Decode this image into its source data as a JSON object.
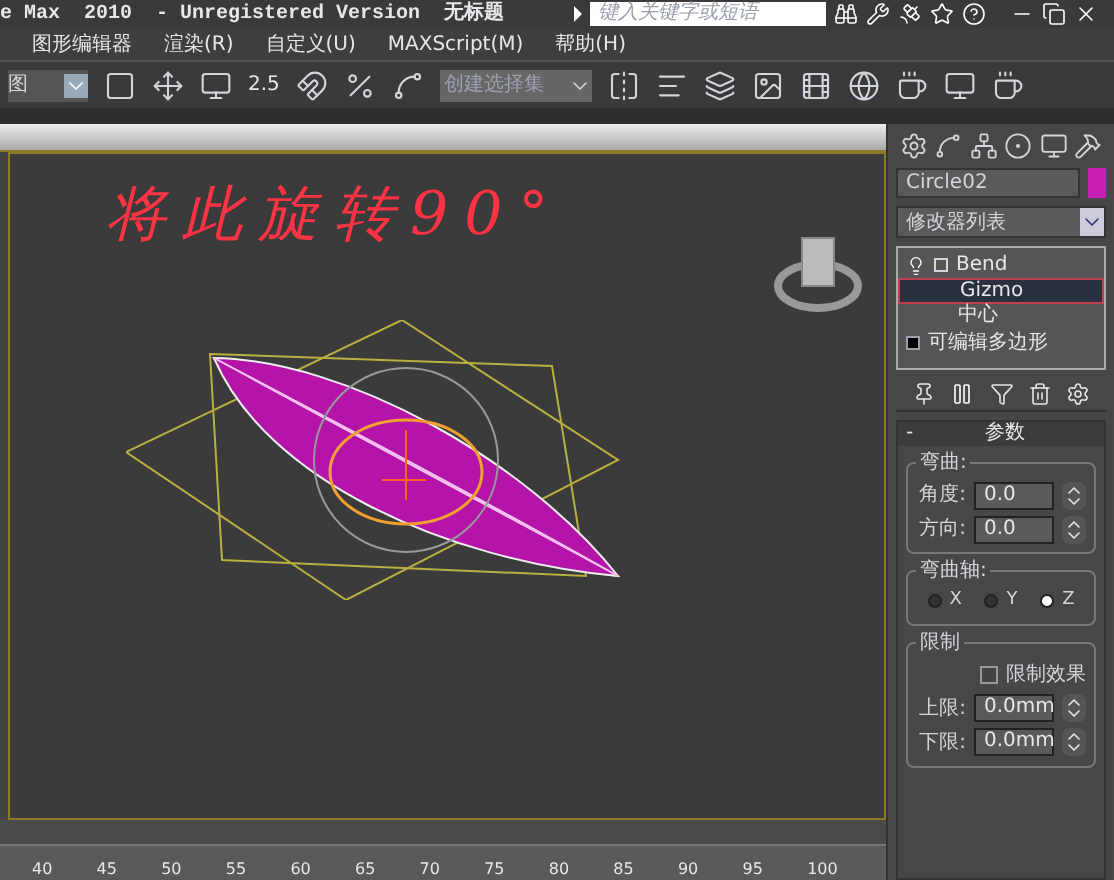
{
  "title_bar": {
    "title": "e Max  2010  - Unregistered Version  无标题",
    "search": {
      "placeholder": "键入关键字或短语"
    }
  },
  "menu": [
    "图形编辑器",
    "渲染(R)",
    "自定义(U)",
    "MAXScript(M)",
    "帮助(H)"
  ],
  "toolbar": {
    "view_dropdown": "图",
    "snap_label": "2.5",
    "selection_set": {
      "placeholder": "创建选择集"
    }
  },
  "viewport": {
    "annotation": "将此旋转90°"
  },
  "command_panel": {
    "object_name": "Circle02",
    "modifier_list": "修改器列表",
    "stack": [
      {
        "label": "Bend",
        "expanded": true,
        "selected": false,
        "children": [
          {
            "label": "Gizmo",
            "selected": true
          },
          {
            "label": "中心",
            "selected": false
          }
        ]
      },
      {
        "label": "可编辑多边形",
        "expanded": false,
        "selected": false
      }
    ],
    "rollout": {
      "title": "参数",
      "toggle": "-",
      "bend": {
        "title": "弯曲:",
        "fields": [
          {
            "label": "角度:",
            "value": "0.0"
          },
          {
            "label": "方向:",
            "value": "0.0"
          }
        ]
      },
      "axis": {
        "title": "弯曲轴:",
        "options": [
          {
            "label": "X",
            "selected": false
          },
          {
            "label": "Y",
            "selected": false
          },
          {
            "label": "Z",
            "selected": true
          }
        ]
      },
      "limits": {
        "title": "限制",
        "effect": {
          "label": "限制效果",
          "checked": false
        },
        "fields": [
          {
            "label": "上限:",
            "value": "0.0mm"
          },
          {
            "label": "下限:",
            "value": "0.0mm"
          }
        ]
      }
    }
  },
  "timeline": {
    "ticks": [
      "40",
      "45",
      "50",
      "55",
      "60",
      "65",
      "70",
      "75",
      "80",
      "85",
      "90",
      "95",
      "100"
    ]
  }
}
